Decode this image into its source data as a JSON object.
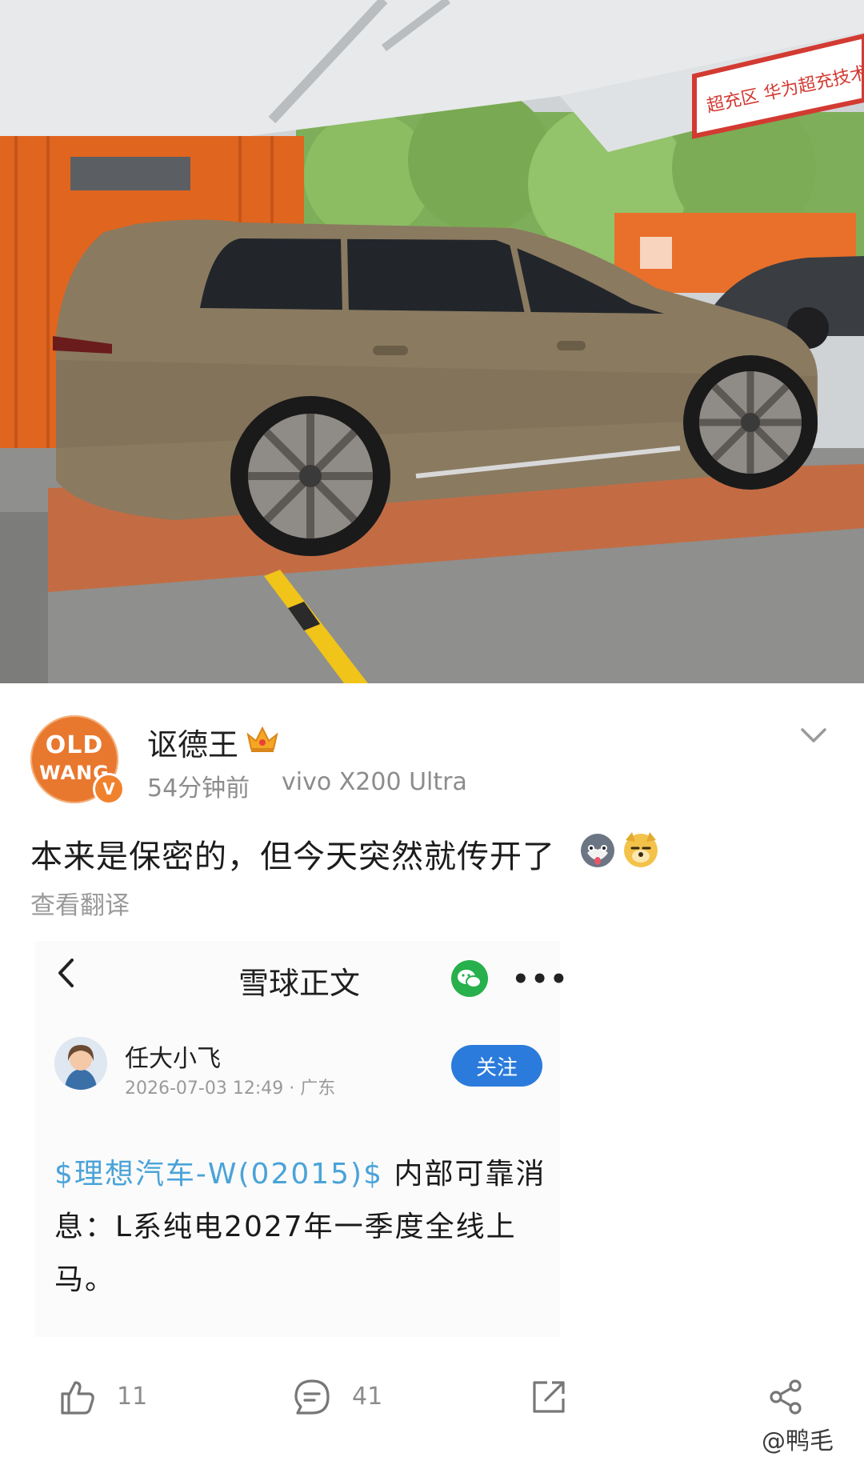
{
  "post": {
    "username": "讴德王",
    "avatar_line1": "OLD",
    "avatar_line2": "WANG",
    "verified_badge": "V",
    "time": "54分钟前",
    "device": "vivo X200 Ultra",
    "text": "本来是保密的，但今天突然就传开了",
    "translate_label": "查看翻译",
    "icons": {
      "crown": "crown-icon",
      "collapse": "chevron-down-icon",
      "emoji_1": "husky-emoji",
      "emoji_2": "doge-emoji"
    }
  },
  "photo": {
    "sign_text": "超充区  华为超充技术支",
    "colors": {
      "car": "#8a7a60",
      "container": "#e0651f",
      "floor": "#8f8f8d",
      "canopy": "#e7e9ea"
    }
  },
  "embed": {
    "title": "雪球正文",
    "author": "任大小飞",
    "timestamp": "2026-07-03 12:49 · 广东",
    "follow_label": "关注",
    "stock_tag": "$理想汽车-W(02015)$",
    "body_text": " 内部可靠消息：L系纯电2027年一季度全线上马。",
    "icons": {
      "back": "back-arrow-icon",
      "wechat": "wechat-icon",
      "more": "more-dots-icon"
    },
    "more_glyph": "•••"
  },
  "toolbar": {
    "like_count": "11",
    "comment_count": "41",
    "icons": [
      "thumbs-up-icon",
      "comment-icon",
      "forward-icon",
      "share-icon"
    ]
  },
  "watermark": "@鸭毛",
  "colors": {
    "accent_blue": "#2b7bdc",
    "stock_link": "#4aa3d8",
    "wechat_green": "#27b04b",
    "brand_orange": "#e9782f"
  }
}
